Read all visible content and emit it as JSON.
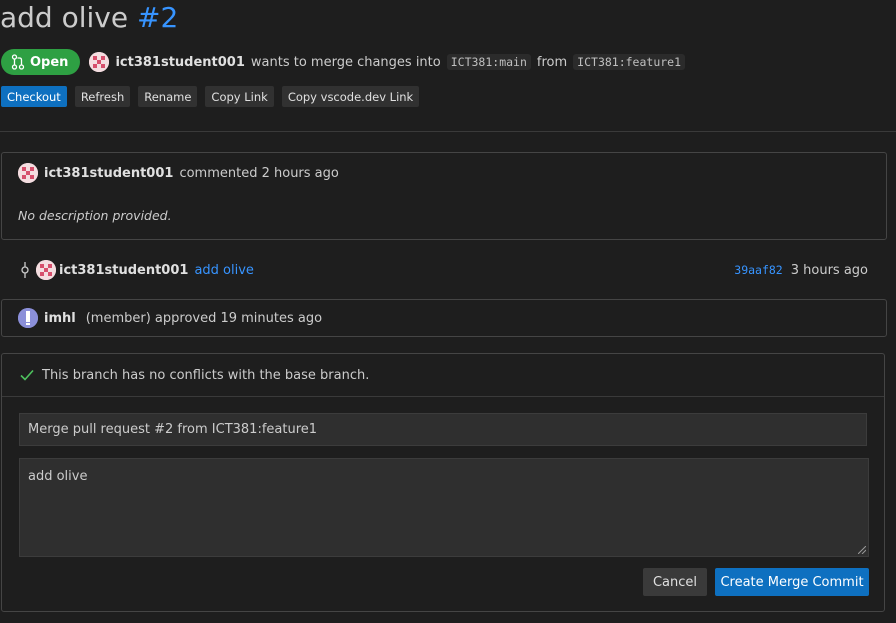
{
  "header": {
    "title": "add olive",
    "number": "#2"
  },
  "status": {
    "badge_label": "Open",
    "author": "ict381student001",
    "text_wants": "wants to merge changes into",
    "target_branch": "ICT381:main",
    "text_from": "from",
    "source_branch": "ICT381:feature1"
  },
  "actions": {
    "checkout": "Checkout",
    "refresh": "Refresh",
    "rename": "Rename",
    "copy_link": "Copy Link",
    "copy_vscode_link": "Copy vscode.dev Link"
  },
  "comment": {
    "author": "ict381student001",
    "meta": "commented 2 hours ago",
    "body": "No description provided."
  },
  "commit": {
    "author": "ict381student001",
    "message": "add olive",
    "sha": "39aaf82",
    "time": "3 hours ago"
  },
  "review": {
    "author": "imhl",
    "text": "(member) approved 19 minutes ago"
  },
  "merge": {
    "status_text": "This branch has no conflicts with the base branch.",
    "title_value": "Merge pull request #2 from ICT381:feature1",
    "body_value": "add olive",
    "cancel_label": "Cancel",
    "submit_label": "Create Merge Commit"
  },
  "colors": {
    "open_badge": "#2ea043",
    "primary": "#0e70c0",
    "link": "#3794ff",
    "background": "#1e1e1e"
  }
}
